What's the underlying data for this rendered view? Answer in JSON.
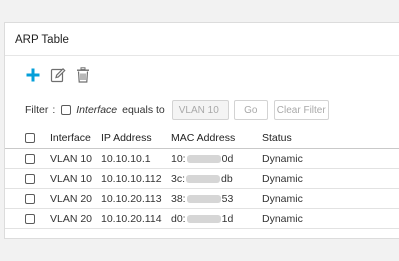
{
  "panel": {
    "title": "ARP Table"
  },
  "toolbar": {
    "add_icon": "plus-icon",
    "edit_icon": "edit-icon",
    "delete_icon": "trash-icon",
    "accent_color": "#049fd9"
  },
  "filter": {
    "label": "Filter",
    "colon": ":",
    "field_name": "Interface",
    "operator": "equals to",
    "value": "VLAN 10",
    "go_label": "Go",
    "clear_label": "Clear Filter"
  },
  "table": {
    "columns": [
      "Interface",
      "IP Address",
      "MAC Address",
      "Status"
    ],
    "rows": [
      {
        "interface": "VLAN 10",
        "ip": "10.10.10.1",
        "mac_prefix": "10:",
        "mac_suffix": "0d",
        "status": "Dynamic"
      },
      {
        "interface": "VLAN 10",
        "ip": "10.10.10.112",
        "mac_prefix": "3c:",
        "mac_suffix": "db",
        "status": "Dynamic"
      },
      {
        "interface": "VLAN 20",
        "ip": "10.10.20.113",
        "mac_prefix": "38:",
        "mac_suffix": "53",
        "status": "Dynamic"
      },
      {
        "interface": "VLAN 20",
        "ip": "10.10.20.114",
        "mac_prefix": "d0:",
        "mac_suffix": "1d",
        "status": "Dynamic"
      }
    ]
  }
}
